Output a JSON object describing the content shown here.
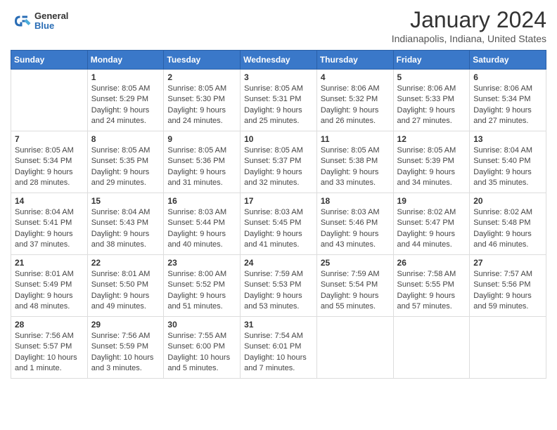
{
  "logo": {
    "general": "General",
    "blue": "Blue"
  },
  "title": "January 2024",
  "subtitle": "Indianapolis, Indiana, United States",
  "weekdays": [
    "Sunday",
    "Monday",
    "Tuesday",
    "Wednesday",
    "Thursday",
    "Friday",
    "Saturday"
  ],
  "weeks": [
    [
      {
        "day": "",
        "sunrise": "",
        "sunset": "",
        "daylight": ""
      },
      {
        "day": "1",
        "sunrise": "Sunrise: 8:05 AM",
        "sunset": "Sunset: 5:29 PM",
        "daylight": "Daylight: 9 hours and 24 minutes."
      },
      {
        "day": "2",
        "sunrise": "Sunrise: 8:05 AM",
        "sunset": "Sunset: 5:30 PM",
        "daylight": "Daylight: 9 hours and 24 minutes."
      },
      {
        "day": "3",
        "sunrise": "Sunrise: 8:05 AM",
        "sunset": "Sunset: 5:31 PM",
        "daylight": "Daylight: 9 hours and 25 minutes."
      },
      {
        "day": "4",
        "sunrise": "Sunrise: 8:06 AM",
        "sunset": "Sunset: 5:32 PM",
        "daylight": "Daylight: 9 hours and 26 minutes."
      },
      {
        "day": "5",
        "sunrise": "Sunrise: 8:06 AM",
        "sunset": "Sunset: 5:33 PM",
        "daylight": "Daylight: 9 hours and 27 minutes."
      },
      {
        "day": "6",
        "sunrise": "Sunrise: 8:06 AM",
        "sunset": "Sunset: 5:34 PM",
        "daylight": "Daylight: 9 hours and 27 minutes."
      }
    ],
    [
      {
        "day": "7",
        "sunrise": "Sunrise: 8:05 AM",
        "sunset": "Sunset: 5:34 PM",
        "daylight": "Daylight: 9 hours and 28 minutes."
      },
      {
        "day": "8",
        "sunrise": "Sunrise: 8:05 AM",
        "sunset": "Sunset: 5:35 PM",
        "daylight": "Daylight: 9 hours and 29 minutes."
      },
      {
        "day": "9",
        "sunrise": "Sunrise: 8:05 AM",
        "sunset": "Sunset: 5:36 PM",
        "daylight": "Daylight: 9 hours and 31 minutes."
      },
      {
        "day": "10",
        "sunrise": "Sunrise: 8:05 AM",
        "sunset": "Sunset: 5:37 PM",
        "daylight": "Daylight: 9 hours and 32 minutes."
      },
      {
        "day": "11",
        "sunrise": "Sunrise: 8:05 AM",
        "sunset": "Sunset: 5:38 PM",
        "daylight": "Daylight: 9 hours and 33 minutes."
      },
      {
        "day": "12",
        "sunrise": "Sunrise: 8:05 AM",
        "sunset": "Sunset: 5:39 PM",
        "daylight": "Daylight: 9 hours and 34 minutes."
      },
      {
        "day": "13",
        "sunrise": "Sunrise: 8:04 AM",
        "sunset": "Sunset: 5:40 PM",
        "daylight": "Daylight: 9 hours and 35 minutes."
      }
    ],
    [
      {
        "day": "14",
        "sunrise": "Sunrise: 8:04 AM",
        "sunset": "Sunset: 5:41 PM",
        "daylight": "Daylight: 9 hours and 37 minutes."
      },
      {
        "day": "15",
        "sunrise": "Sunrise: 8:04 AM",
        "sunset": "Sunset: 5:43 PM",
        "daylight": "Daylight: 9 hours and 38 minutes."
      },
      {
        "day": "16",
        "sunrise": "Sunrise: 8:03 AM",
        "sunset": "Sunset: 5:44 PM",
        "daylight": "Daylight: 9 hours and 40 minutes."
      },
      {
        "day": "17",
        "sunrise": "Sunrise: 8:03 AM",
        "sunset": "Sunset: 5:45 PM",
        "daylight": "Daylight: 9 hours and 41 minutes."
      },
      {
        "day": "18",
        "sunrise": "Sunrise: 8:03 AM",
        "sunset": "Sunset: 5:46 PM",
        "daylight": "Daylight: 9 hours and 43 minutes."
      },
      {
        "day": "19",
        "sunrise": "Sunrise: 8:02 AM",
        "sunset": "Sunset: 5:47 PM",
        "daylight": "Daylight: 9 hours and 44 minutes."
      },
      {
        "day": "20",
        "sunrise": "Sunrise: 8:02 AM",
        "sunset": "Sunset: 5:48 PM",
        "daylight": "Daylight: 9 hours and 46 minutes."
      }
    ],
    [
      {
        "day": "21",
        "sunrise": "Sunrise: 8:01 AM",
        "sunset": "Sunset: 5:49 PM",
        "daylight": "Daylight: 9 hours and 48 minutes."
      },
      {
        "day": "22",
        "sunrise": "Sunrise: 8:01 AM",
        "sunset": "Sunset: 5:50 PM",
        "daylight": "Daylight: 9 hours and 49 minutes."
      },
      {
        "day": "23",
        "sunrise": "Sunrise: 8:00 AM",
        "sunset": "Sunset: 5:52 PM",
        "daylight": "Daylight: 9 hours and 51 minutes."
      },
      {
        "day": "24",
        "sunrise": "Sunrise: 7:59 AM",
        "sunset": "Sunset: 5:53 PM",
        "daylight": "Daylight: 9 hours and 53 minutes."
      },
      {
        "day": "25",
        "sunrise": "Sunrise: 7:59 AM",
        "sunset": "Sunset: 5:54 PM",
        "daylight": "Daylight: 9 hours and 55 minutes."
      },
      {
        "day": "26",
        "sunrise": "Sunrise: 7:58 AM",
        "sunset": "Sunset: 5:55 PM",
        "daylight": "Daylight: 9 hours and 57 minutes."
      },
      {
        "day": "27",
        "sunrise": "Sunrise: 7:57 AM",
        "sunset": "Sunset: 5:56 PM",
        "daylight": "Daylight: 9 hours and 59 minutes."
      }
    ],
    [
      {
        "day": "28",
        "sunrise": "Sunrise: 7:56 AM",
        "sunset": "Sunset: 5:57 PM",
        "daylight": "Daylight: 10 hours and 1 minute."
      },
      {
        "day": "29",
        "sunrise": "Sunrise: 7:56 AM",
        "sunset": "Sunset: 5:59 PM",
        "daylight": "Daylight: 10 hours and 3 minutes."
      },
      {
        "day": "30",
        "sunrise": "Sunrise: 7:55 AM",
        "sunset": "Sunset: 6:00 PM",
        "daylight": "Daylight: 10 hours and 5 minutes."
      },
      {
        "day": "31",
        "sunrise": "Sunrise: 7:54 AM",
        "sunset": "Sunset: 6:01 PM",
        "daylight": "Daylight: 10 hours and 7 minutes."
      },
      {
        "day": "",
        "sunrise": "",
        "sunset": "",
        "daylight": ""
      },
      {
        "day": "",
        "sunrise": "",
        "sunset": "",
        "daylight": ""
      },
      {
        "day": "",
        "sunrise": "",
        "sunset": "",
        "daylight": ""
      }
    ]
  ]
}
